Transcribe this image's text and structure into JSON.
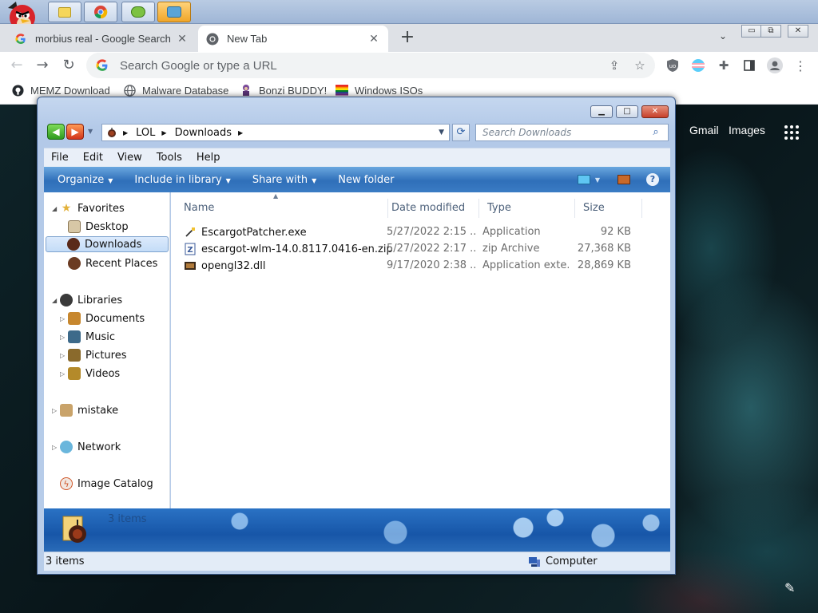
{
  "taskbar": {
    "buttons": [
      {
        "icon": "bird-icon"
      },
      {
        "icon": "sun-folder-icon"
      },
      {
        "icon": "chrome-icon"
      },
      {
        "icon": "frog-icon"
      },
      {
        "icon": "users-icon",
        "active": true
      }
    ]
  },
  "browser": {
    "tabs": [
      {
        "title": "morbius real - Google Search",
        "favicon": "google-icon",
        "active": false
      },
      {
        "title": "New Tab",
        "favicon": "chrome-icon",
        "active": true
      }
    ],
    "omnibox_placeholder": "Search Google or type a URL",
    "bookmarks": [
      {
        "label": "MEMZ Download",
        "icon": "github-icon"
      },
      {
        "label": "Malware Database",
        "icon": "globe-icon"
      },
      {
        "label": "Bonzi BUDDY!",
        "icon": "bonzi-icon"
      },
      {
        "label": "Windows ISOs",
        "icon": "rainbow-flag-icon"
      }
    ]
  },
  "newtab_page": {
    "links": [
      "Gmail",
      "Images"
    ]
  },
  "explorer": {
    "breadcrumb": [
      "LOL",
      "Downloads"
    ],
    "search_placeholder": "Search Downloads",
    "menus": [
      "File",
      "Edit",
      "View",
      "Tools",
      "Help"
    ],
    "commands": [
      {
        "label": "Organize",
        "dropdown": true
      },
      {
        "label": "Include in library",
        "dropdown": true
      },
      {
        "label": "Share with",
        "dropdown": true
      },
      {
        "label": "New folder",
        "dropdown": false
      }
    ],
    "nav": {
      "favorites": {
        "label": "Favorites",
        "items": [
          "Desktop",
          "Downloads",
          "Recent Places"
        ],
        "selected": "Downloads"
      },
      "libraries": {
        "label": "Libraries",
        "items": [
          "Documents",
          "Music",
          "Pictures",
          "Videos"
        ]
      },
      "mistake": "mistake",
      "network": "Network",
      "image_catalog": "Image Catalog"
    },
    "columns": [
      "Name",
      "Date modified",
      "Type",
      "Size"
    ],
    "files": [
      {
        "name": "EscargotPatcher.exe",
        "date": "5/27/2022 2:15 ...",
        "type": "Application",
        "size": "92 KB",
        "icon": "exe-icon"
      },
      {
        "name": "escargot-wlm-14.0.8117.0416-en.zip",
        "date": "5/27/2022 2:17 ...",
        "type": "zip Archive",
        "size": "27,368 KB",
        "icon": "zip-icon"
      },
      {
        "name": "opengl32.dll",
        "date": "9/17/2020 2:38 ...",
        "type": "Application exte...",
        "size": "28,869 KB",
        "icon": "dll-icon"
      }
    ],
    "details_count": "3 items",
    "status_left": "3 items",
    "status_right": "Computer"
  }
}
